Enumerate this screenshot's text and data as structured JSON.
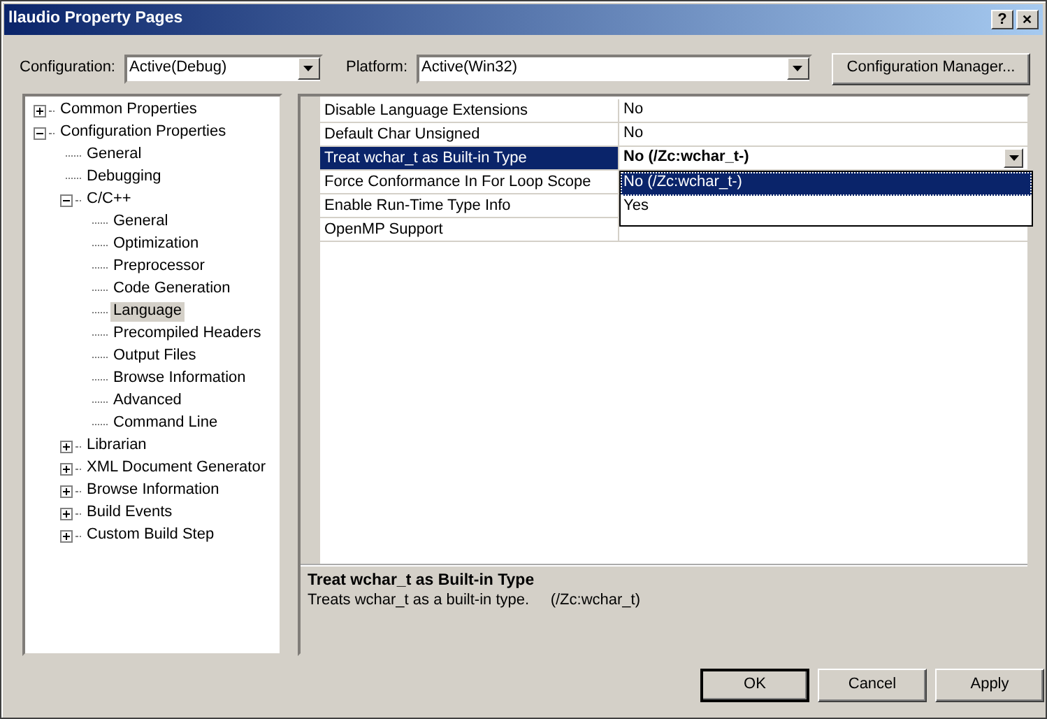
{
  "window": {
    "title": "llaudio Property Pages",
    "buttons": [
      {
        "kind": "help",
        "label": "?"
      },
      {
        "kind": "close",
        "label": "✕"
      }
    ]
  },
  "configuration": {
    "label": "Configuration:",
    "value": "Active(Debug)"
  },
  "platform": {
    "label": "Platform:",
    "value": "Active(Win32)"
  },
  "manager_button": "Configuration Manager...",
  "tree": [
    {
      "label": "Common Properties",
      "expanded": false,
      "selected": false
    },
    {
      "label": "Configuration Properties",
      "expanded": true,
      "selected": false,
      "children": [
        {
          "label": "General",
          "selected": false
        },
        {
          "label": "Debugging",
          "selected": false
        },
        {
          "label": "C/C++",
          "expanded": true,
          "selected": false,
          "children": [
            {
              "label": "General",
              "selected": false
            },
            {
              "label": "Optimization",
              "selected": false
            },
            {
              "label": "Preprocessor",
              "selected": false
            },
            {
              "label": "Code Generation",
              "selected": false
            },
            {
              "label": "Language",
              "selected": true
            },
            {
              "label": "Precompiled Headers",
              "selected": false
            },
            {
              "label": "Output Files",
              "selected": false
            },
            {
              "label": "Browse Information",
              "selected": false
            },
            {
              "label": "Advanced",
              "selected": false
            },
            {
              "label": "Command Line",
              "selected": false
            }
          ]
        },
        {
          "label": "Librarian",
          "expanded": false,
          "selected": false
        },
        {
          "label": "XML Document Generator",
          "expanded": false,
          "selected": false
        },
        {
          "label": "Browse Information",
          "expanded": false,
          "selected": false
        },
        {
          "label": "Build Events",
          "expanded": false,
          "selected": false
        },
        {
          "label": "Custom Build Step",
          "expanded": false,
          "selected": false
        }
      ]
    }
  ],
  "properties": [
    {
      "name": "Disable Language Extensions",
      "value": "No",
      "selected": false
    },
    {
      "name": "Default Char Unsigned",
      "value": "No",
      "selected": false
    },
    {
      "name": "Treat wchar_t as Built-in Type",
      "value": "No (/Zc:wchar_t-)",
      "selected": true
    },
    {
      "name": "Force Conformance In For Loop Scope",
      "selected": false
    },
    {
      "name": "Enable Run-Time Type Info",
      "selected": false
    },
    {
      "name": "OpenMP Support",
      "selected": false
    }
  ],
  "dropdown_options": [
    {
      "label": "No (/Zc:wchar_t-)",
      "selected": true
    },
    {
      "label": "Yes",
      "selected": false
    }
  ],
  "description": {
    "title": "Treat wchar_t as Built-in Type",
    "text": "Treats wchar_t as a built-in type.     (/Zc:wchar_t)"
  },
  "buttons": [
    {
      "label": "OK",
      "default": true
    },
    {
      "label": "Cancel",
      "default": false
    },
    {
      "label": "Apply",
      "default": false
    }
  ]
}
